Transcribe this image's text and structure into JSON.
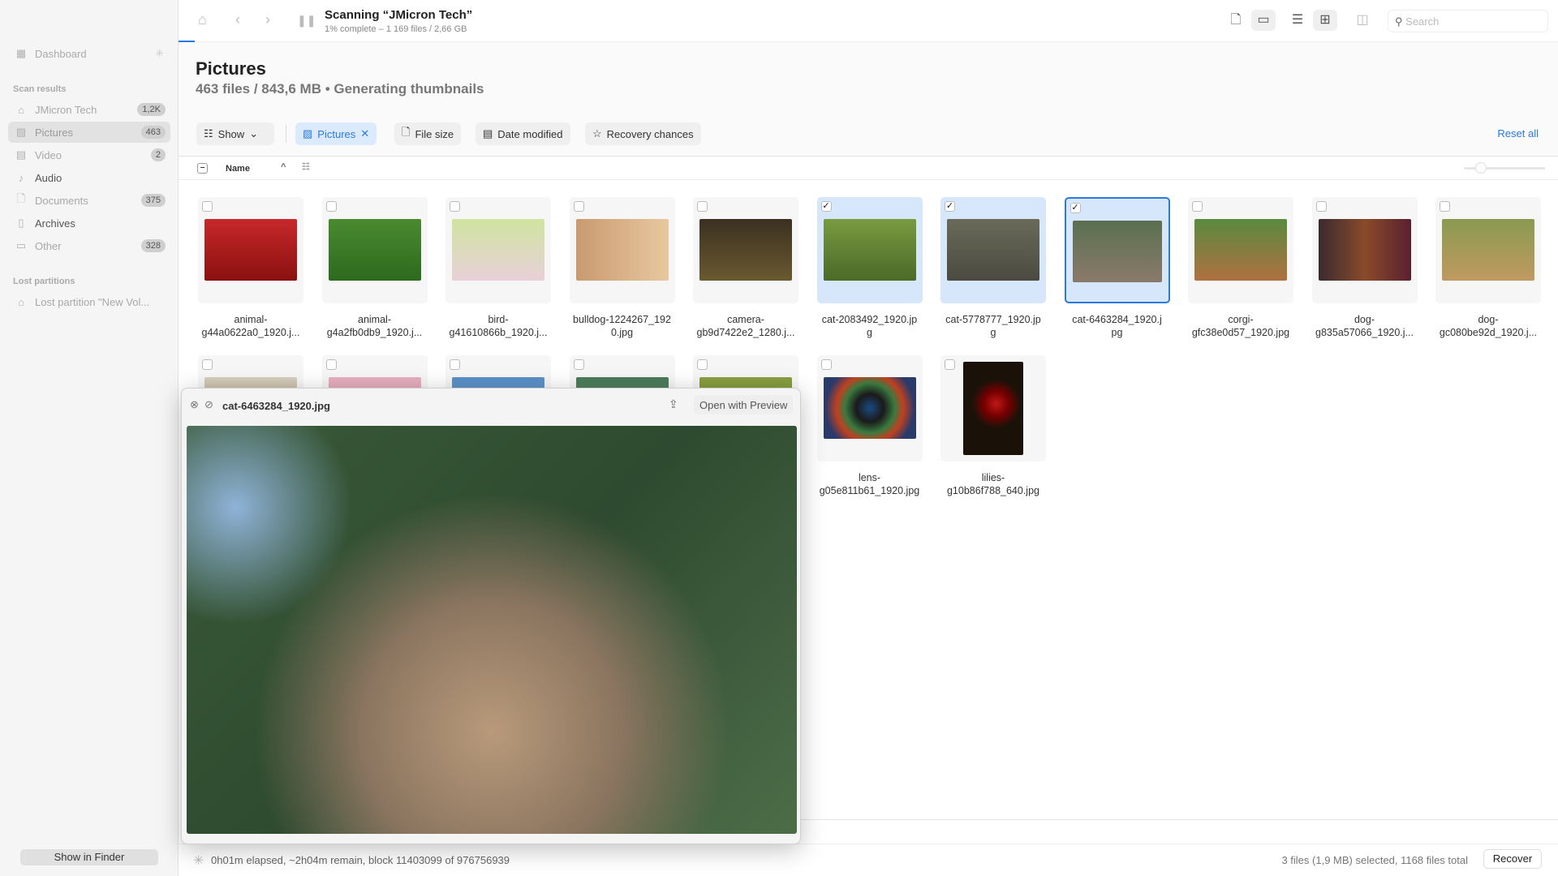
{
  "sidebar": {
    "dashboard": "Dashboard",
    "scan_results": "Scan results",
    "items": [
      {
        "label": "JMicron Tech",
        "count": "1,2K",
        "icon": "drive-icon"
      },
      {
        "label": "Pictures",
        "count": "463",
        "icon": "photo-icon"
      },
      {
        "label": "Video",
        "count": "2",
        "icon": "film-icon"
      },
      {
        "label": "Audio",
        "count": "",
        "icon": "music-note-icon"
      },
      {
        "label": "Documents",
        "count": "375",
        "icon": "document-icon"
      },
      {
        "label": "Archives",
        "count": "",
        "icon": "archive-icon"
      },
      {
        "label": "Other",
        "count": "328",
        "icon": "file-icon"
      }
    ],
    "lost_partitions": "Lost partitions",
    "lost_item": "Lost partition \"New Vol...",
    "show_in_finder": "Show in Finder"
  },
  "toolbar": {
    "title": "Scanning “JMicron Tech”",
    "subtitle": "1% complete – 1 169 files / 2,66 GB",
    "search_placeholder": "Search",
    "progress_percent": 1
  },
  "header": {
    "title": "Pictures",
    "summary": "463 files / 843,6 MB • Generating thumbnails"
  },
  "filters": {
    "show": "Show",
    "pictures": "Pictures",
    "file_size": "File size",
    "date_modified": "Date modified",
    "recovery_chances": "Recovery chances",
    "reset_all": "Reset all"
  },
  "columns": {
    "name": "Name"
  },
  "files": [
    {
      "name": "animal-\ng44a0622a0_1920.j...",
      "bg": "linear-gradient(#c8282a,#8a1010)",
      "state": ""
    },
    {
      "name": "animal-\ng4a2fb0db9_1920.j...",
      "bg": "linear-gradient(#4a8a30,#2d6a1e)",
      "state": ""
    },
    {
      "name": "bird-\ng41610866b_1920.j...",
      "bg": "linear-gradient(#cfe4a0,#e8d0d8)",
      "state": ""
    },
    {
      "name": "bulldog-1224267_192\n0.jpg",
      "bg": "linear-gradient(90deg,#c99a70,#e8c8a0)",
      "state": ""
    },
    {
      "name": "camera-\ngb9d7422e2_1280.j...",
      "bg": "linear-gradient(#3a3020,#6a5a30)",
      "state": ""
    },
    {
      "name": "cat-2083492_1920.jp\ng",
      "bg": "linear-gradient(#7a9a40,#4a6a28)",
      "state": "sel"
    },
    {
      "name": "cat-5778777_1920.jp\ng",
      "bg": "linear-gradient(#6a6a5a,#4a4a40)",
      "state": "sel"
    },
    {
      "name": "cat-6463284_1920.j\npg",
      "bg": "linear-gradient(#5a7050,#8a7a6a)",
      "state": "cur"
    },
    {
      "name": "corgi-\ngfc38e0d57_1920.jpg",
      "bg": "linear-gradient(#5a8a40,#b07040)",
      "state": ""
    },
    {
      "name": "dog-\ng835a57066_1920.j...",
      "bg": "linear-gradient(90deg,#3a2a30,#8a4a2a,#5a2030)",
      "state": ""
    },
    {
      "name": "dog-\ngc080be92d_1920.j...",
      "bg": "linear-gradient(#8a9a50,#c09a60)",
      "state": ""
    },
    {
      "name": "",
      "bg": "linear-gradient(#d8d0c0,#8a7040)",
      "state": ""
    },
    {
      "name": "",
      "bg": "linear-gradient(#e8b0c0,#d890a8)",
      "state": ""
    },
    {
      "name": "",
      "bg": "linear-gradient(#5a90c8,#6aa0d0)",
      "state": ""
    },
    {
      "name": "",
      "bg": "linear-gradient(#4a7a5a,#6a9a70)",
      "state": ""
    },
    {
      "name": "",
      "bg": "linear-gradient(#8aa040,#6a8030)",
      "state": ""
    },
    {
      "name": "lens-\ng05e811b61_1920.jpg",
      "bg": "radial-gradient(circle,#1a4a80 0,#1a1a1a 25%,#3a7a40 45%,#c04020 60%,#2a3a6a 80%)",
      "state": ""
    },
    {
      "name": "lilies-\ng10b86f788_640.jpg",
      "bg": "radial-gradient(circle at 55% 45%,#c01818 0,#700 20%,#1a1208 40%)",
      "state": ""
    }
  ],
  "preview": {
    "filename": "cat-6463284_1920.jpg",
    "open_with": "Open with Preview"
  },
  "status": {
    "elapsed": "0h01m elapsed, ~2h04m remain, block 11403099 of 976756939",
    "selection": "3 files (1,9 MB) selected, 1168 files total",
    "recover": "Recover"
  },
  "colors": {
    "accent": "#2a7ae2",
    "selected_tile": "#d6e7fb"
  }
}
